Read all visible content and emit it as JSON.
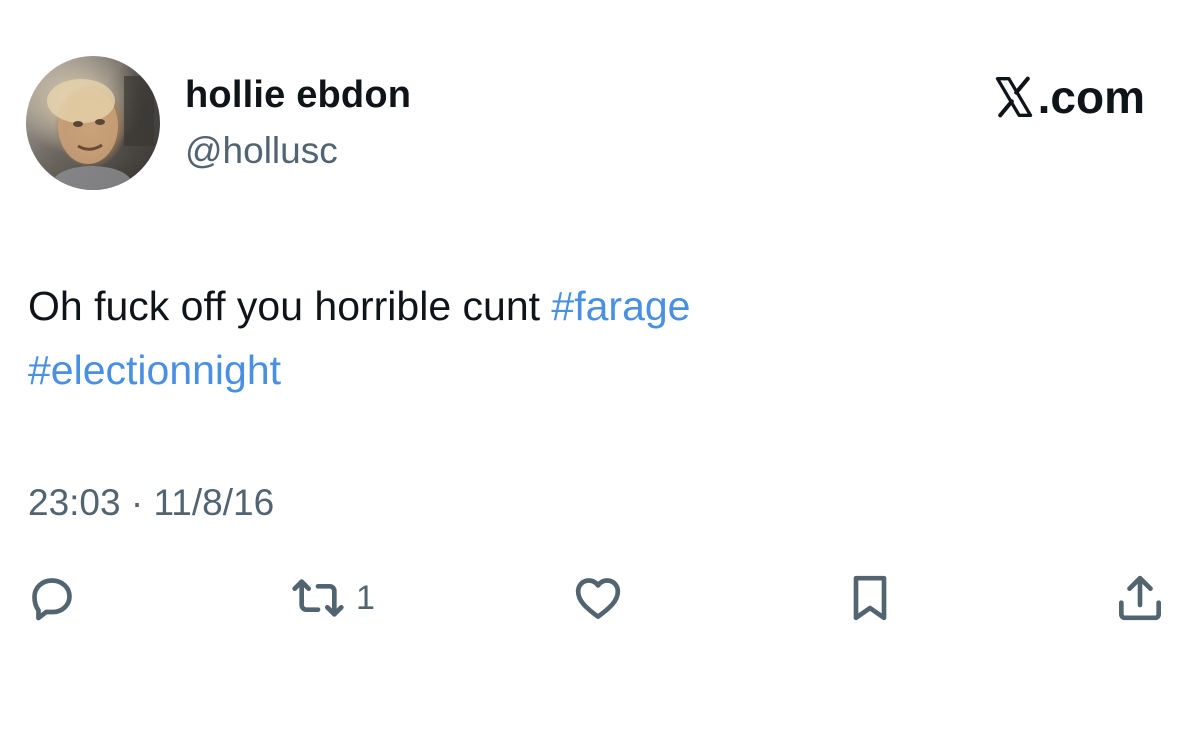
{
  "user": {
    "display_name": "hollie ebdon",
    "handle": "@hollusc",
    "avatar_icon": "profile-photo"
  },
  "brand": {
    "label": ".com",
    "logo_icon": "x-logo-icon"
  },
  "tweet": {
    "text_plain": "Oh fuck off you horrible cunt ",
    "hashtag_1": "#farage",
    "hashtag_2": "#electionnight",
    "timestamp": "23:03 · 11/8/16"
  },
  "actions": {
    "reply_icon": "reply-icon",
    "retweet_icon": "retweet-icon",
    "retweet_count": "1",
    "like_icon": "heart-icon",
    "bookmark_icon": "bookmark-icon",
    "share_icon": "share-icon"
  },
  "colors": {
    "text": "#0f1419",
    "secondary": "#536471",
    "hashtag": "#4a90e2",
    "background": "#ffffff"
  }
}
